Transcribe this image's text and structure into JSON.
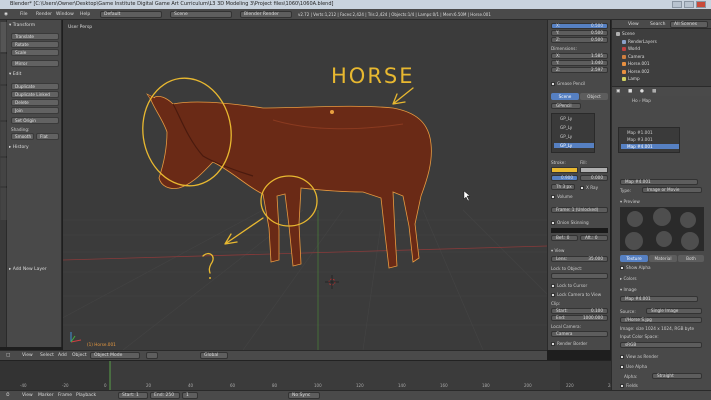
{
  "window": {
    "title": "Blender* [C:\\Users\\Owner\\Desktop\\Game Institute Digital Game Art Curriculum\\L3 3D Modeling 3\\Project files\\1060\\1060A.blend]"
  },
  "infobar": {
    "menus": [
      "File",
      "Render",
      "Window",
      "Help"
    ],
    "layout": "Default",
    "scene": "Scene",
    "engine": "Blender Render",
    "stats": "v2.72 | Verts:1,212 | Faces:2,424 | Tris:2,424 | Objects:1/4 | Lamps:0/1 | Mem:6.50M | Horse.001"
  },
  "tool_shelf": {
    "tabs": [
      "Tools",
      "Create",
      "Relations",
      "Animation",
      "Physics",
      "Grease Pencil"
    ],
    "transform_header": "Transform",
    "transform_buttons": [
      "Translate",
      "Rotate",
      "Scale",
      "Mirror"
    ],
    "edit_header": "Edit",
    "edit_buttons": [
      "Duplicate",
      "Duplicate Linked",
      "Delete",
      "Join"
    ],
    "set_origin": "Set Origin",
    "shading_label": "Shading:",
    "shading_buttons": [
      "Smooth",
      "Flat"
    ],
    "history_header": "History",
    "add_layer": "Add New Layer"
  },
  "viewport": {
    "view_label": "User Persp",
    "object_label": "(1) Horse.001",
    "annotations": {
      "horse_text": "HORSE",
      "question": "?"
    }
  },
  "view3d_header": {
    "menus": [
      "View",
      "Select",
      "Add",
      "Object"
    ],
    "mode": "Object Mode",
    "pivot": "Global"
  },
  "npanel": {
    "x_label": "X:",
    "x_value": "0.500",
    "y_label": "Y:",
    "y_value": "0.500",
    "z_label": "Z:",
    "z_value": "0.500",
    "dimensions_header": "Dimensions:",
    "dx": "1.585",
    "dy": "1.040",
    "dz": "2.597",
    "grease_header": "Grease Pencil",
    "gp_tabs": [
      "Scene",
      "Object"
    ],
    "gp_name": "GPencil",
    "gp_layers": [
      "GP_Ly",
      "GP_Ly",
      "GP_Ly",
      "GP_Ly"
    ],
    "stroke_label": "Stroke:",
    "fill_label": "Fill:",
    "stroke_value": "0.900",
    "fill_value": "0.000",
    "thickness": "Th 3 px",
    "xray": "X Ray",
    "volume": "Volume",
    "frame_field": "Frame: 1 (Unlocked)",
    "onion": "Onion Skinning",
    "before_after": [
      "Bef.: 0",
      "Aft.: 0"
    ],
    "view_header": "View",
    "lens_label": "Lens:",
    "lens_value": "35.000",
    "lock_object": "Lock to Object:",
    "lock_cursor": "Lock to Cursor",
    "lock_camera": "Lock Camera to View",
    "clip_label": "Clip:",
    "start_label": "Start:",
    "start_value": "0.100",
    "end_label": "End:",
    "end_value": "1000.000",
    "local_camera": "Local Camera:",
    "camera": "Camera",
    "render_border": "Render Border"
  },
  "outliner": {
    "header": [
      "View",
      "Search",
      "All Scenes"
    ],
    "items": [
      {
        "name": "Scene",
        "color": "#b0b0b0"
      },
      {
        "name": "RenderLayers",
        "color": "#8aa0c8"
      },
      {
        "name": "World",
        "color": "#c04040"
      },
      {
        "name": "Camera",
        "color": "#d08040"
      },
      {
        "name": "Horse.001",
        "color": "#e89040"
      },
      {
        "name": "Horse.002",
        "color": "#e89040"
      },
      {
        "name": "Lamp",
        "color": "#d0d060"
      }
    ]
  },
  "properties": {
    "breadcrumb": [
      "Ho",
      "Map"
    ],
    "texture_slots": [
      "Map #1.001",
      "Map #3.001",
      "Map #4.001"
    ],
    "texture_name": "Map #4.001",
    "type_label": "Type:",
    "type_value": "Image or Movie",
    "preview_header": "Preview",
    "preview_tabs": [
      "Texture",
      "Material",
      "Both"
    ],
    "show_alpha": "Show Alpha",
    "colors_header": "Colors",
    "image_header": "Image",
    "image_name": "Map #4.001",
    "source_label": "Source:",
    "source_value": "Single Image",
    "file_path": "//Horse S.jpg",
    "image_info": "Image: size 1024 x 1024, RGB byte",
    "color_space_label": "Input Color Space:",
    "color_space_value": "sRGB",
    "view_as_render": "View as Render",
    "use_alpha": "Use Alpha",
    "alpha_label": "Alpha:",
    "alpha_value": "Straight",
    "fields": "Fields"
  },
  "timeline": {
    "ticks": [
      "-40",
      "-20",
      "0",
      "20",
      "40",
      "60",
      "80",
      "100",
      "120",
      "140",
      "160",
      "180",
      "200",
      "220",
      "240",
      "260"
    ],
    "menus": [
      "View",
      "Marker",
      "Frame",
      "Playback"
    ],
    "start_field": "Start: 1",
    "end_field": "End: 250",
    "current": "1",
    "sync": "No Sync"
  },
  "colors": {
    "annotation": "#e8b830",
    "horse_body": "#6a2a16",
    "selected_blue": "#5680c2",
    "viewport_bg": "#3b3b3b"
  }
}
